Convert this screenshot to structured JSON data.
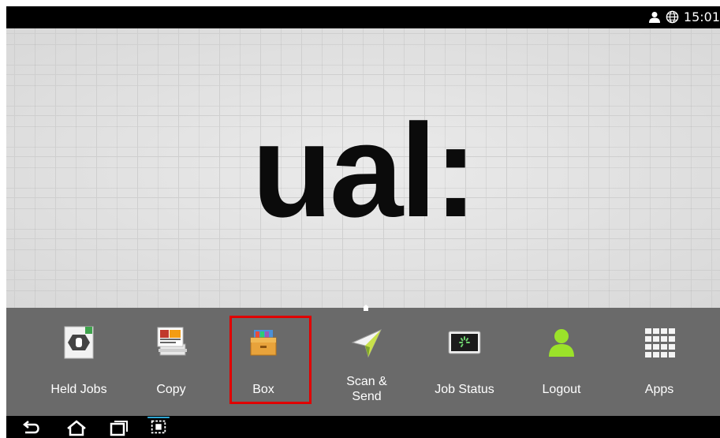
{
  "status_bar": {
    "time": "15:01",
    "icons": [
      "person-icon",
      "globe-icon"
    ]
  },
  "wallpaper": {
    "logo_text": "ual:"
  },
  "dock": {
    "items": [
      {
        "label": "Held Jobs",
        "icon": "held-jobs-icon"
      },
      {
        "label": "Copy",
        "icon": "copy-icon"
      },
      {
        "label": "Box",
        "icon": "box-icon",
        "selected": true
      },
      {
        "label": "Scan &\nSend",
        "icon": "scan-send-icon"
      },
      {
        "label": "Job Status",
        "icon": "job-status-icon"
      },
      {
        "label": "Logout",
        "icon": "logout-icon"
      },
      {
        "label": "Apps",
        "icon": "apps-grid-icon"
      }
    ]
  },
  "nav_bar": {
    "buttons": [
      "back-icon",
      "home-icon",
      "recents-icon",
      "screenshot-icon"
    ]
  },
  "colors": {
    "dock": "#6a6a6a",
    "selection": "#e00000",
    "logout_green": "#9be22a"
  }
}
